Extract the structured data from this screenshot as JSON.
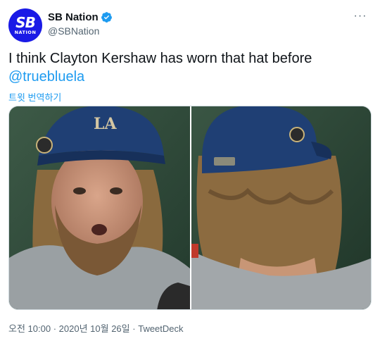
{
  "account": {
    "display_name": "SB Nation",
    "handle": "@SBNation",
    "avatar_line1": "SB",
    "avatar_line2": "NATION"
  },
  "menu": {
    "more_label": "···"
  },
  "tweet": {
    "text": "I think Clayton Kershaw has worn that hat before",
    "mention": "@truebluela",
    "translate_label": "트윗 번역하기"
  },
  "media": {
    "cap_logo_text": "LA"
  },
  "footer": {
    "time": "오전 10:00",
    "separator": "·",
    "date": "2020년 10월 26일",
    "source": "TweetDeck"
  },
  "colors": {
    "accent": "#1d9bf0",
    "avatar_bg": "#1a1ae6",
    "cap_blue": "#1f3f74"
  }
}
